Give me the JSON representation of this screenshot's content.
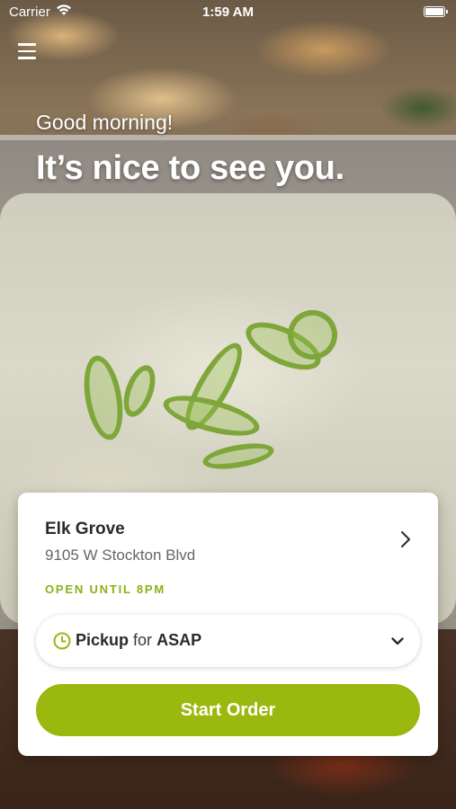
{
  "status_bar": {
    "carrier": "Carrier",
    "time": "1:59 AM"
  },
  "greeting": {
    "salutation": "Good morning!",
    "headline": "It’s nice to see you."
  },
  "store": {
    "name": "Elk Grove",
    "address": "9105 W Stockton Blvd",
    "hours": "OPEN UNTIL 8PM"
  },
  "order_mode": {
    "method": "Pickup",
    "connector": "for",
    "time": "ASAP"
  },
  "actions": {
    "start_order": "Start Order"
  },
  "colors": {
    "accent": "#9ab80e",
    "hours_text": "#8bb014"
  },
  "icons": {
    "menu": "hamburger-menu-icon",
    "wifi": "wifi-icon",
    "battery": "battery-icon",
    "store_nav": "chevron-right-icon",
    "clock": "clock-icon",
    "dropdown": "chevron-down-icon"
  }
}
